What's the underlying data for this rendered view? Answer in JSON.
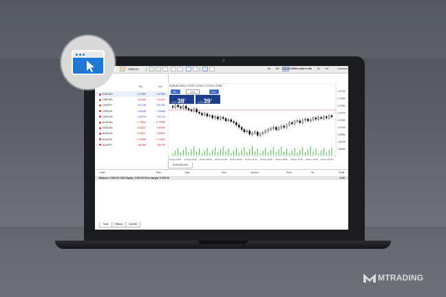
{
  "toolbar": {
    "menu_options": "Options",
    "account_text": "23137644: AdmiralMarkets",
    "account_right": "s Account",
    "timeframes": [
      "M1",
      "M5",
      "M15",
      "M30",
      "H1",
      "H4",
      "D1",
      "W1"
    ],
    "active_timeframe": "M15"
  },
  "market_watch": {
    "col_bid": "Bid",
    "col_ask": "Ask",
    "rows": [
      {
        "symbol": "EURUSD",
        "bid": "1.07381",
        "ask": "1.07390",
        "color": "blue"
      },
      {
        "symbol": "GBPUSD",
        "bid": "1.51452",
        "ask": "1.51462",
        "color": "red"
      },
      {
        "symbol": "USDJPY",
        "bid": "123.148",
        "ask": "123.161",
        "color": "blue"
      },
      {
        "symbol": "USDCHF",
        "bid": "1.00436",
        "ask": "1.00466",
        "color": "blue"
      },
      {
        "symbol": "USDCAD",
        "bid": "1.32709",
        "ask": "1.32714",
        "color": "blue"
      },
      {
        "symbol": "AUDUSD",
        "bid": "0.70554",
        "ask": "0.70566",
        "color": "red"
      },
      {
        "symbol": "NZDUSD",
        "bid": "0.65491",
        "ask": "0.65509",
        "color": "red"
      },
      {
        "symbol": "AUDCAD",
        "bid": "0.93627",
        "ask": "0.93652",
        "color": "red"
      },
      {
        "symbol": "AUDCHF",
        "bid": "0.70868",
        "ask": "0.70892",
        "color": "red"
      },
      {
        "symbol": "AUDJPY",
        "bid": "86.885",
        "ask": "86.909",
        "color": "red"
      }
    ],
    "tab_label": "Symbols"
  },
  "chart": {
    "title": "EURUSD,M15 1.07478 1.07491 1.07375 1.07381",
    "sell_label": "SELL",
    "buy_label": "BUY",
    "lot_value": "0.01",
    "sell_price_prefix": "1.07",
    "sell_price_main": "38",
    "sell_price_sup": "1",
    "buy_price_prefix": "1.07",
    "buy_price_main": "39",
    "buy_price_sup": "0",
    "price_axis": [
      "1.07730",
      "1.07590",
      "1.07381",
      "1.07370",
      "1.07250",
      "1.07140",
      "1.06980",
      "1.06740",
      "1.06450"
    ],
    "time_axis": [
      "19 Nov 2015",
      "20 Nov 03:30",
      "20 Nov 05:30",
      "20 Nov 07:30",
      "20 Nov 09:30",
      "20 Nov 11:30",
      "20 Nov 13:30",
      "20 Nov 15:30",
      "20 Nov 17:30",
      "20 Nov 19:30",
      "20 Nov 21:30"
    ],
    "tab_label": "EURUSD,M15",
    "colors": {
      "bull": "#ffffff",
      "bear": "#000000",
      "volume": "#3cbd3c",
      "level": "#e06060"
    }
  },
  "terminal": {
    "columns": [
      "Order",
      "Time",
      "Type",
      "Size",
      "Symbol",
      "Price",
      "S/L",
      "Profit"
    ],
    "balance_text": "Balance: 5 000.00 USD  Equity: 5 000.00  Free margin: 5 000.00",
    "profit_value": "0.00",
    "tabs": [
      "Trade",
      "History",
      "Journal"
    ]
  },
  "brand": {
    "name": "MTRADING",
    "accent": "#1e78d6"
  }
}
